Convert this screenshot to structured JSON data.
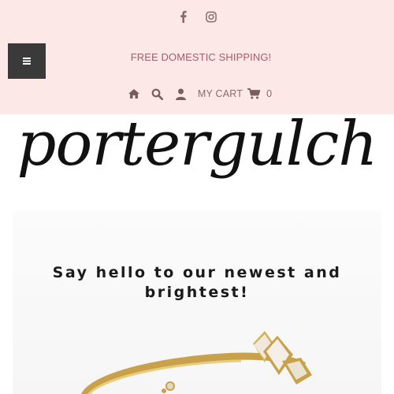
{
  "header": {
    "promo_text": "FREE DOMESTIC SHIPPING!",
    "cart_label": "MY CART",
    "cart_count": "0",
    "social_icons": [
      "facebook-icon",
      "instagram-icon"
    ],
    "nav_icons": [
      "home-icon",
      "search-icon",
      "account-icon",
      "cart-icon"
    ],
    "colors": {
      "topbar_bg": "#fde8e8",
      "promo_text": "#a25c6e",
      "menu_button_bg": "#3a3a3a"
    }
  },
  "logo": {
    "text": "portergulch"
  },
  "hero": {
    "headline_line1": "Say hello to our newest and",
    "headline_line2": "brightest!"
  }
}
